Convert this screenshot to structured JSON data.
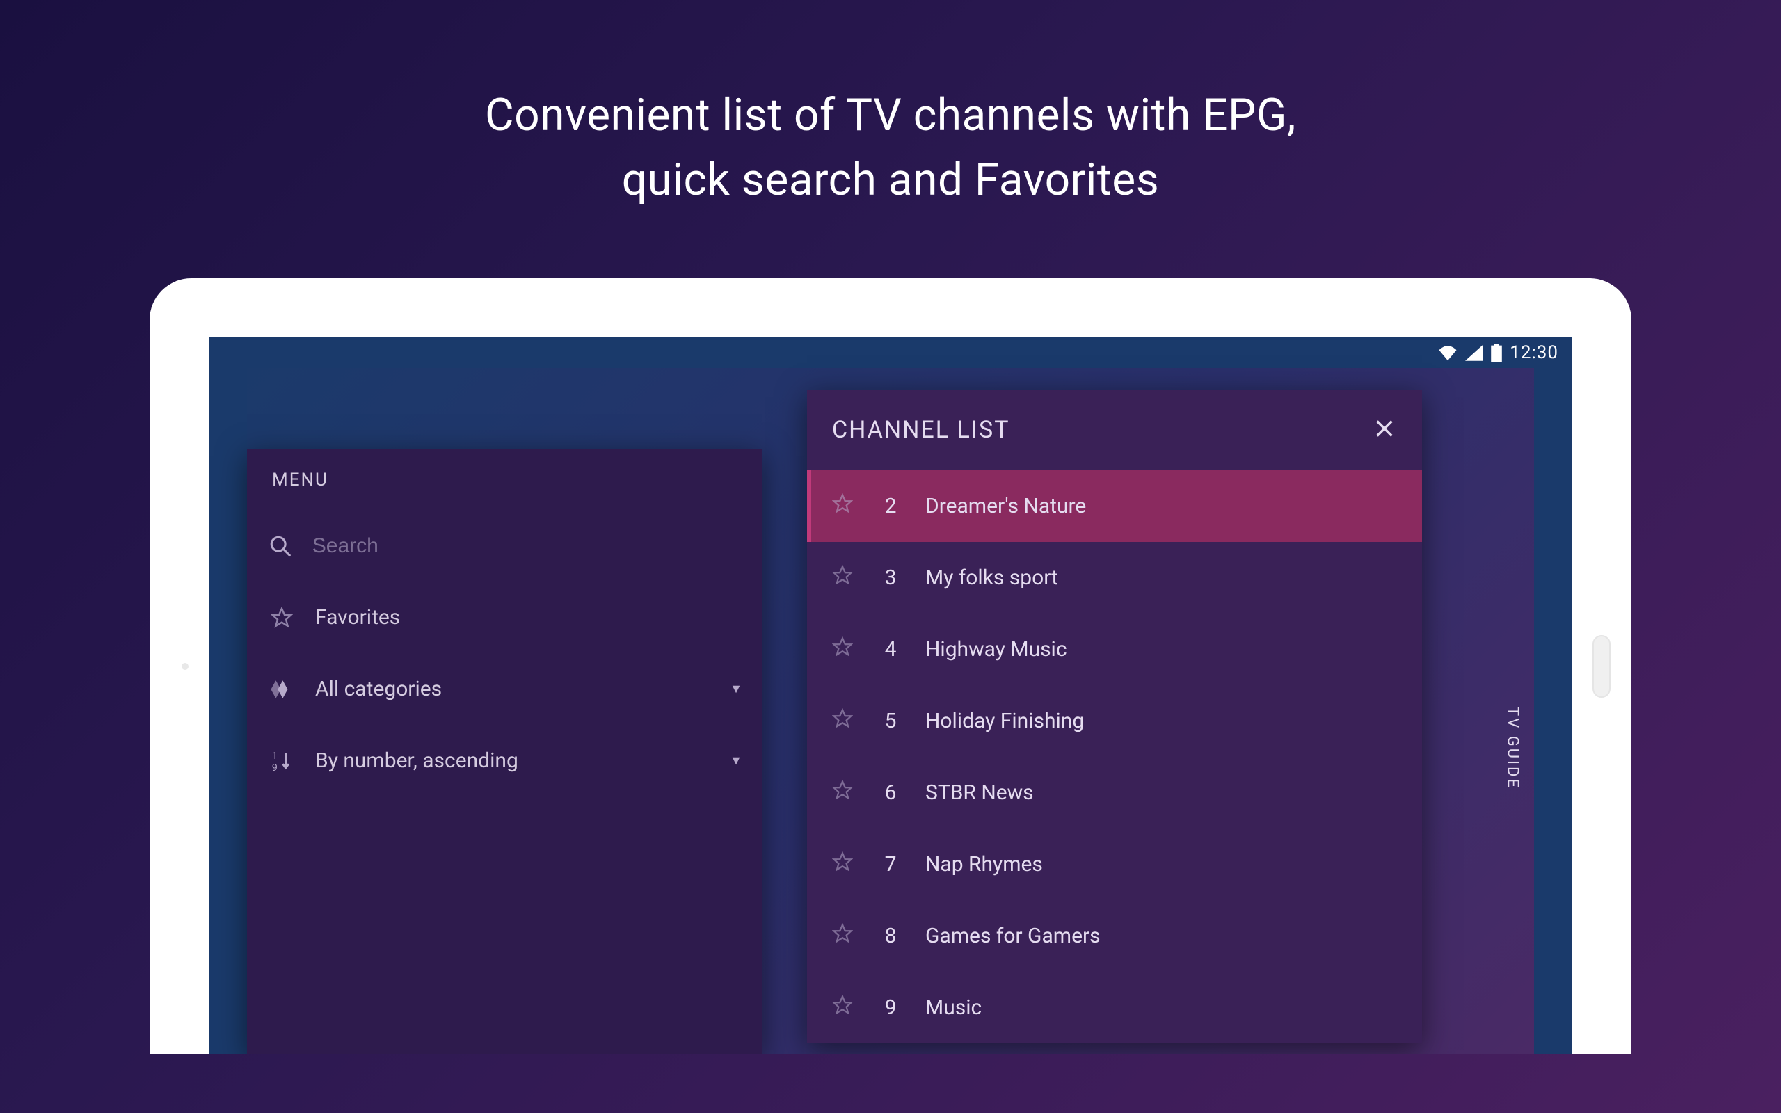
{
  "headline_line1": "Convenient list of TV channels with EPG,",
  "headline_line2": "quick search and Favorites",
  "statusbar": {
    "time": "12:30"
  },
  "menu": {
    "title": "MENU",
    "search_placeholder": "Search",
    "favorites_label": "Favorites",
    "categories_label": "All categories",
    "sort_label": "By number, ascending"
  },
  "channel_list": {
    "title": "CHANNEL LIST",
    "items": [
      {
        "num": "2",
        "name": "Dreamer's Nature",
        "selected": true
      },
      {
        "num": "3",
        "name": "My folks sport",
        "selected": false
      },
      {
        "num": "4",
        "name": "Highway Music",
        "selected": false
      },
      {
        "num": "5",
        "name": "Holiday Finishing",
        "selected": false
      },
      {
        "num": "6",
        "name": "STBR News",
        "selected": false
      },
      {
        "num": "7",
        "name": "Nap Rhymes",
        "selected": false
      },
      {
        "num": "8",
        "name": "Games for Gamers",
        "selected": false
      },
      {
        "num": "9",
        "name": "Music",
        "selected": false
      }
    ]
  },
  "tvguide_label": "TV GUIDE"
}
